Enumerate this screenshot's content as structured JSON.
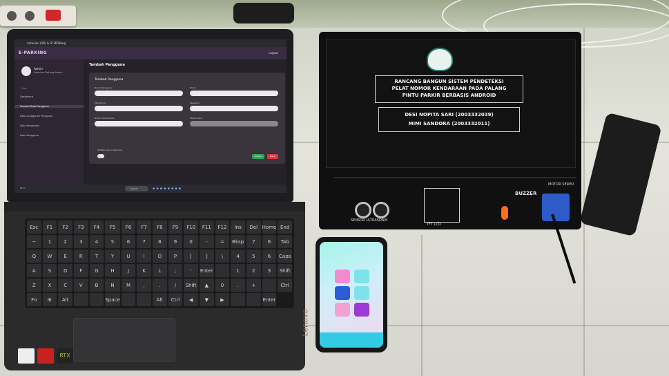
{
  "laptop": {
    "window_title": "Antavian (XR) & IP 360Bang",
    "app_name": "E-PARKING",
    "logout_label": "Logout",
    "user_name": "Admin",
    "user_role": "Sebelum Datang Admin",
    "menu_heading": "Main",
    "menu_items": [
      {
        "label": "Dashboard",
        "active": false
      },
      {
        "label": "Tambah Data Pengguna",
        "active": true
      },
      {
        "label": "Data Langganan Pengguna",
        "active": false
      },
      {
        "label": "Data Kendaraan",
        "active": false
      },
      {
        "label": "Data Pengguna",
        "active": false
      }
    ],
    "page_title": "Tambah Pengguna",
    "form_title": "Tambah Pengguna",
    "form_fields": [
      {
        "label": "Nama Pengguna",
        "disabled": false
      },
      {
        "label": "Email",
        "disabled": false
      },
      {
        "label": "Plat Nomor",
        "disabled": false
      },
      {
        "label": "Password",
        "disabled": false
      },
      {
        "label": "Nomor Handphone",
        "disabled": false
      },
      {
        "label": "Status Akun",
        "disabled": true
      }
    ],
    "toggle_label": "Aktifkan Akun Sekarang",
    "submit_label": "Simpan",
    "cancel_label": "Batal",
    "taskbar_search": "Search",
    "taskbar_weather": "31°C",
    "brand": "Lenovo",
    "graphics_badge": "RTX"
  },
  "device_box": {
    "title_lines": [
      "RANCANG BANGUN SISTEM PENDETEKSI",
      "PELAT NOMOR KENDARAAN PADA PALANG",
      "PINTU PARKIR BERBASIS ANDROID"
    ],
    "author_lines": [
      "DESI NOPITA SARI (2003332039)",
      "MIMI SANDORA (2003332011)"
    ],
    "front_labels": {
      "sensor": "SENSOR ULTRASONIK",
      "lcd": "TFT LCD",
      "buzzer": "BUZZER",
      "servo": "MOTOR SERVO"
    },
    "colors": {
      "case": "#0f0f10",
      "led": "#ff6d16",
      "servo": "#2d5cc9"
    }
  },
  "phone": {
    "tile_colors": [
      "#f38ad0",
      "#7de3ea",
      "#2a5dd6",
      "#7de3ea",
      "#f3a0d4",
      "#9b3ad6"
    ],
    "nav_color": "#31cbe4"
  },
  "keyboard_keys": [
    "Esc",
    "F1",
    "F2",
    "F3",
    "F4",
    "F5",
    "F6",
    "F7",
    "F8",
    "F9",
    "F10",
    "F11",
    "F12",
    "Ins",
    "Del",
    "Home",
    "End",
    "~",
    "1",
    "2",
    "3",
    "4",
    "5",
    "6",
    "7",
    "8",
    "9",
    "0",
    "-",
    "=",
    "Bksp",
    "7",
    "8",
    "Tab",
    "Q",
    "W",
    "E",
    "R",
    "T",
    "Y",
    "U",
    "I",
    "O",
    "P",
    "[",
    "]",
    "\\",
    "4",
    "5",
    "6",
    "Caps",
    "A",
    "S",
    "D",
    "F",
    "G",
    "H",
    "J",
    "K",
    "L",
    ";",
    "'",
    "Enter",
    "",
    "1",
    "2",
    "3",
    "Shift",
    "Z",
    "X",
    "C",
    "V",
    "B",
    "N",
    "M",
    ",",
    ".",
    "/",
    "Shift",
    "▲",
    "0",
    ".",
    "+",
    "",
    "Ctrl",
    "Fn",
    "⊞",
    "Alt",
    "",
    "",
    "Space",
    "",
    "",
    "Alt",
    "Ctrl",
    "◀",
    "▼",
    "▶",
    "",
    "",
    "Enter"
  ]
}
